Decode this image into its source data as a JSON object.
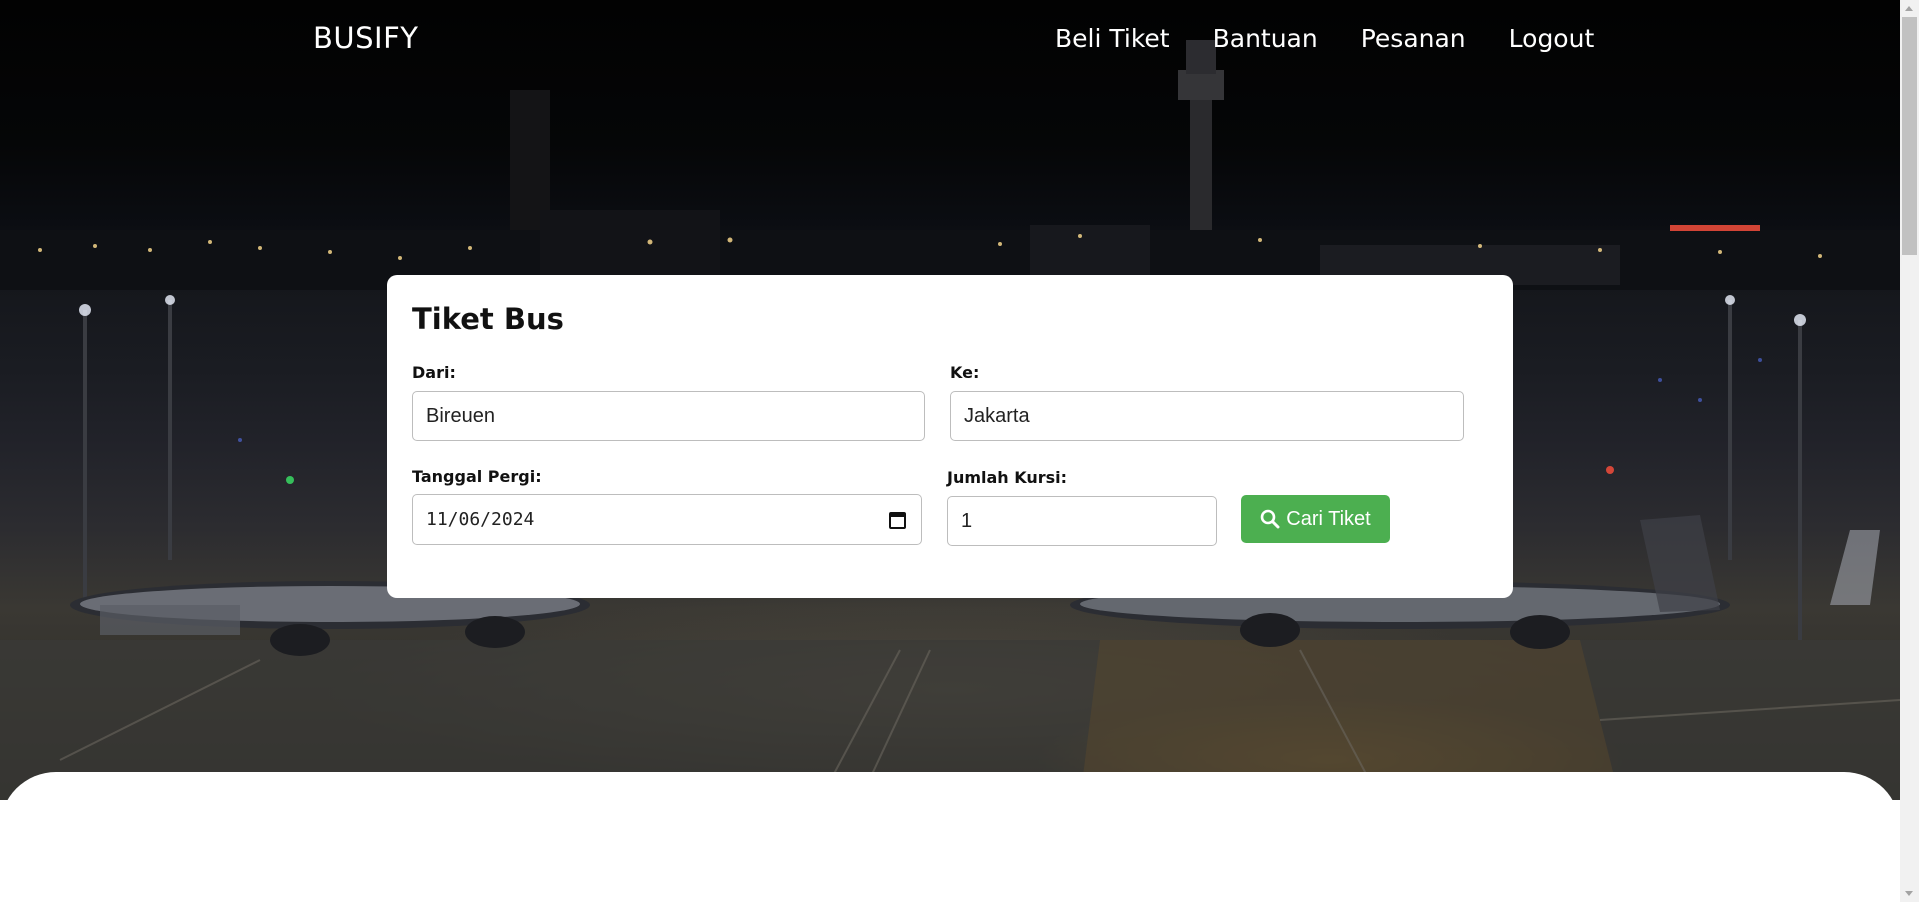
{
  "brand": "BUSIFY",
  "nav": {
    "items": [
      "Beli Tiket",
      "Bantuan",
      "Pesanan",
      "Logout"
    ]
  },
  "card": {
    "title": "Tiket Bus",
    "from_label": "Dari:",
    "from_value": "Bireuen",
    "to_label": "Ke:",
    "to_value": "Jakarta",
    "date_label": "Tanggal Pergi:",
    "date_value": "11/06/2024",
    "seats_label": "Jumlah Kursi:",
    "seats_value": "1",
    "search_button": "Cari Tiket"
  },
  "colors": {
    "accent_green": "#4caf50",
    "card_bg": "#ffffff",
    "nav_text": "#ffffff"
  },
  "icons": {
    "search_button_icon": "search-icon",
    "date_picker_icon": "calendar-icon"
  }
}
